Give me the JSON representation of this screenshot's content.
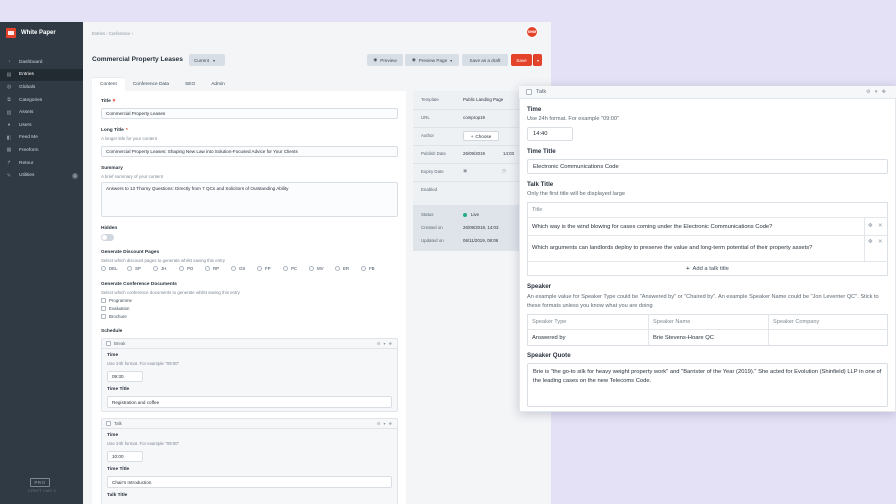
{
  "brand": {
    "name": "White Paper"
  },
  "sidebar": {
    "items": [
      {
        "label": "Dashboard",
        "icon": "dashboard-icon",
        "glyph": "◔"
      },
      {
        "label": "Entries",
        "icon": "entries-icon",
        "glyph": "▤",
        "active": true
      },
      {
        "label": "Globals",
        "icon": "globe-icon",
        "glyph": "◍"
      },
      {
        "label": "Categories",
        "icon": "categories-icon",
        "glyph": "⧉"
      },
      {
        "label": "Assets",
        "icon": "assets-icon",
        "glyph": "▨"
      },
      {
        "label": "Users",
        "icon": "users-icon",
        "glyph": "●"
      },
      {
        "label": "Feed Me",
        "icon": "feedme-icon",
        "glyph": "◧"
      },
      {
        "label": "Freeform",
        "icon": "freeform-icon",
        "glyph": "▦"
      },
      {
        "label": "Retour",
        "icon": "retour-icon",
        "glyph": "↱"
      },
      {
        "label": "Utilities",
        "icon": "utilities-icon",
        "glyph": "✎",
        "badge": "1"
      }
    ],
    "pro_badge": "PRO",
    "footer": "CRAFT CMS 3"
  },
  "header": {
    "breadcrumb": "Entries › Conference ›",
    "title": "Commercial Property Leases",
    "current_label": "Current",
    "preview_label": "Preview",
    "preview_page_label": "Preview Page",
    "save_draft_label": "Save as a draft",
    "save_label": "Save",
    "avatar_text": "SHIM"
  },
  "tabs": [
    "Content",
    "Conference Data",
    "SEO",
    "Admin"
  ],
  "form": {
    "title_label": "Title",
    "title_value": "Commercial Property Leases",
    "long_title_label": "Long Title",
    "long_title_hint": "A longer title for your content",
    "long_title_value": "Commercial Property Leases: Shaping New Law into Solution-Focused Advice for Your Clients",
    "summary_label": "Summary",
    "summary_hint": "A brief summary of your content",
    "summary_value": "Answers to 13 Thorny Questions: Directly from 7 QCs and Solicitors of Outstanding Ability",
    "hidden_label": "Hidden",
    "discount_label": "Generate Discount Pages",
    "discount_hint": "Select which discount pages to generate whilst saving this entry",
    "discount_options": [
      "DEL",
      "SP",
      "JH",
      "PO",
      "RP",
      "GS",
      "FP",
      "PC",
      "MV",
      "ER",
      "FB"
    ],
    "conf_docs_label": "Generate Conference Documents",
    "conf_docs_hint": "Select which conference documents to generate whilst saving this entry",
    "conf_docs_options": [
      "Programme",
      "Evaluation",
      "Brochure"
    ],
    "schedule_label": "Schedule",
    "blocks": [
      {
        "type": "Break",
        "time_label": "Time",
        "time_hint": "Use 24h format. For example \"09:00\"",
        "time_value": "09:30",
        "time_title_label": "Time Title",
        "time_title_value": "Registration and coffee"
      },
      {
        "type": "Talk",
        "time_label": "Time",
        "time_hint": "Use 24h format. For example \"09:00\"",
        "time_value": "10:00",
        "time_title_label": "Time Title",
        "time_title_value": "Chair's Introduction",
        "talk_title_label": "Talk Title"
      }
    ]
  },
  "meta": {
    "template_label": "Template",
    "template_value": "Public Landing Page",
    "url_label": "URL",
    "url_value": "comprop19",
    "author_label": "Author",
    "author_button": "Choose",
    "publish_label": "Publish Date",
    "publish_date": "26/09/2019",
    "publish_time": "14:03",
    "expiry_label": "Expiry Date",
    "enabled_label": "Enabled",
    "status_label": "Status",
    "status_value": "Live",
    "created_label": "Created on",
    "created_value": "26/09/2019, 14:03",
    "updated_label": "Updated on",
    "updated_value": "06/11/2019, 08:09"
  },
  "overlay": {
    "block_type": "Talk",
    "time_label": "Time",
    "time_hint": "Use 24h format. For example \"09:00\"",
    "time_value": "14:40",
    "time_title_label": "Time Title",
    "time_title_value": "Electronic Communications Code",
    "talk_title_label": "Talk Title",
    "talk_title_hint": "Only the first title will be displayed large",
    "talk_table_header": "Title",
    "talk_rows": [
      "Which way is the wind blowing for cases coming under the Electronic Communications Code?",
      "Which arguments can landlords deploy to preserve the value and long-term potential of their property assets?"
    ],
    "add_talk_title": "Add a talk title",
    "speaker_label": "Speaker",
    "speaker_hint": "An example value for Speaker Type could be \"Answered by\" or \"Chaired by\". An example Speaker Name could be \"Jon Leverrier QC\". Stick to these formats unless you know what you are doing",
    "speaker_columns": [
      "Speaker Type",
      "Speaker Name",
      "Speaker Company"
    ],
    "speaker_row": [
      "Answered by",
      "Brie Stevens-Hoare QC",
      ""
    ],
    "quote_label": "Speaker Quote",
    "quote_value": "Brie is \"the go-to silk for heavy weight property work\" and \"Barrister of the Year (2019).\" She acted for Evolution (Shinfield) LLP in one of the leading cases on the new Telecoms Code."
  },
  "colors": {
    "accent": "#e5422b",
    "sidebar": "#2f3a44",
    "background": "#e4e1f6",
    "live": "#27ab83"
  }
}
